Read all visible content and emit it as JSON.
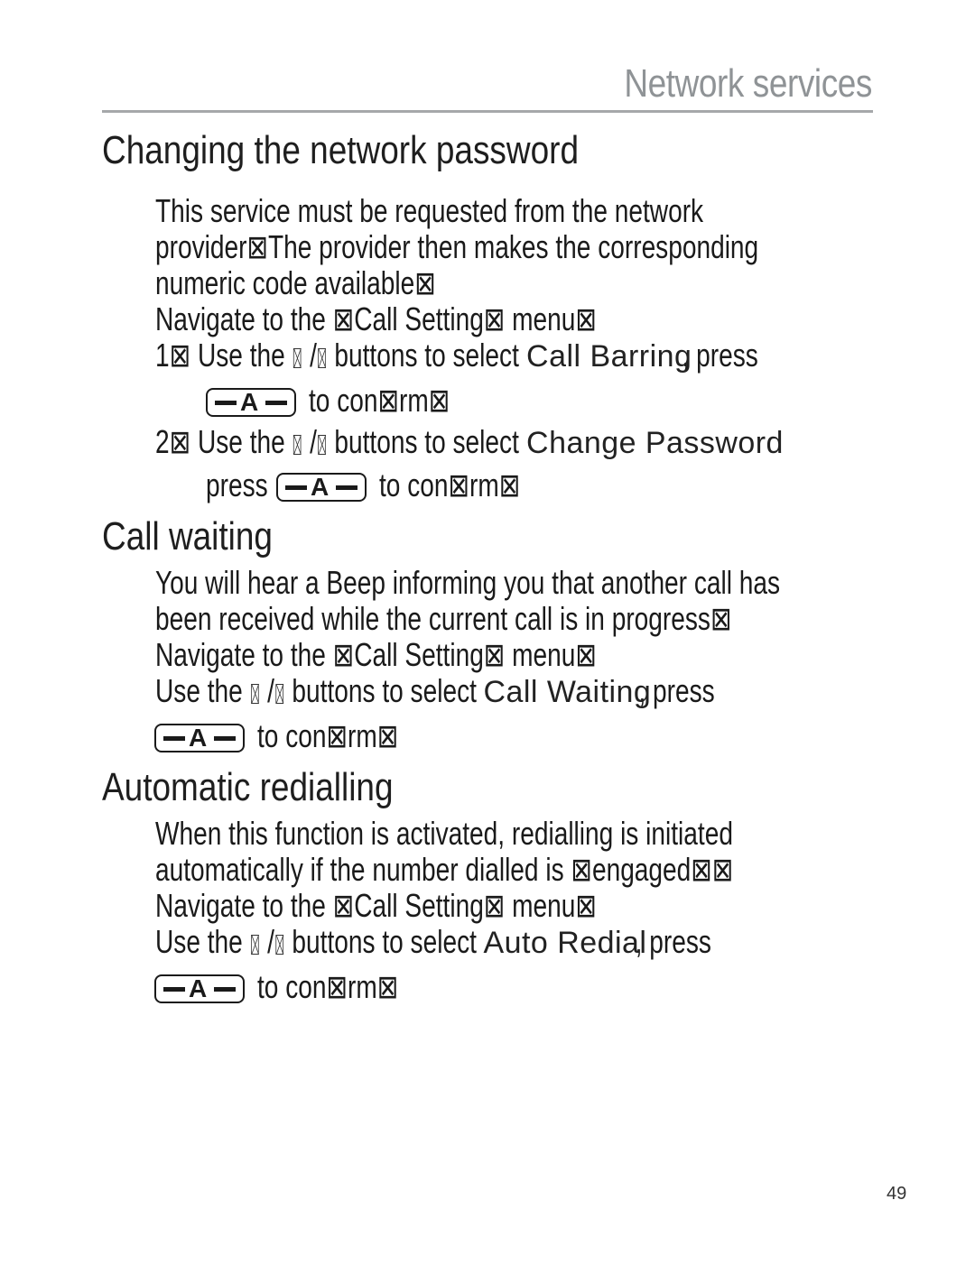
{
  "header": {
    "section_title": "Network services"
  },
  "sections": [
    {
      "title": "Changing the network password",
      "intro_lines": [
        "This service must be requested from the network",
        "provider⊠The provider then makes the corresponding",
        "numeric code available⊠"
      ],
      "navigate": "Navigate to the ⊠Call Setting⊠ menu⊠",
      "steps": [
        {
          "num": "1⊠",
          "prefix": "Use the",
          "sep": "/",
          "mid": "buttons to select",
          "menu_item": "Call Barring",
          "suffix": ", press",
          "confirm": "to con⊠rm⊠"
        },
        {
          "num": "2⊠",
          "prefix": "Use the",
          "sep": "/",
          "mid": "buttons to select",
          "menu_item": "Change Password",
          "press": "press",
          "confirm": "to con⊠rm⊠"
        }
      ]
    },
    {
      "title": "Call waiting",
      "intro_lines": [
        "You will hear a Beep informing you that another call has",
        "been received while the current call is in progress⊠"
      ],
      "navigate": "Navigate to the ⊠Call Setting⊠ menu⊠",
      "instruction": {
        "prefix": "Use the",
        "sep": "/",
        "mid": "buttons to select",
        "menu_item": "Call Waiting",
        "suffix": ", press",
        "confirm": "to con⊠rm⊠"
      }
    },
    {
      "title": "Automatic redialling",
      "intro_lines": [
        "When this function is activated, redialling is initiated",
        "automatically if the number dialled is ⊠engaged⊠⊠"
      ],
      "navigate": "Navigate to the ⊠Call Setting⊠ menu⊠",
      "instruction": {
        "prefix": "Use the",
        "sep": "/",
        "mid": "buttons to select",
        "menu_item": "Auto Redial",
        "suffix": ", press",
        "confirm": "to con⊠rm⊠"
      }
    }
  ],
  "key_icon": {
    "name": "ok-key-icon",
    "letter": "A"
  },
  "footer": {
    "page_number": "49"
  }
}
